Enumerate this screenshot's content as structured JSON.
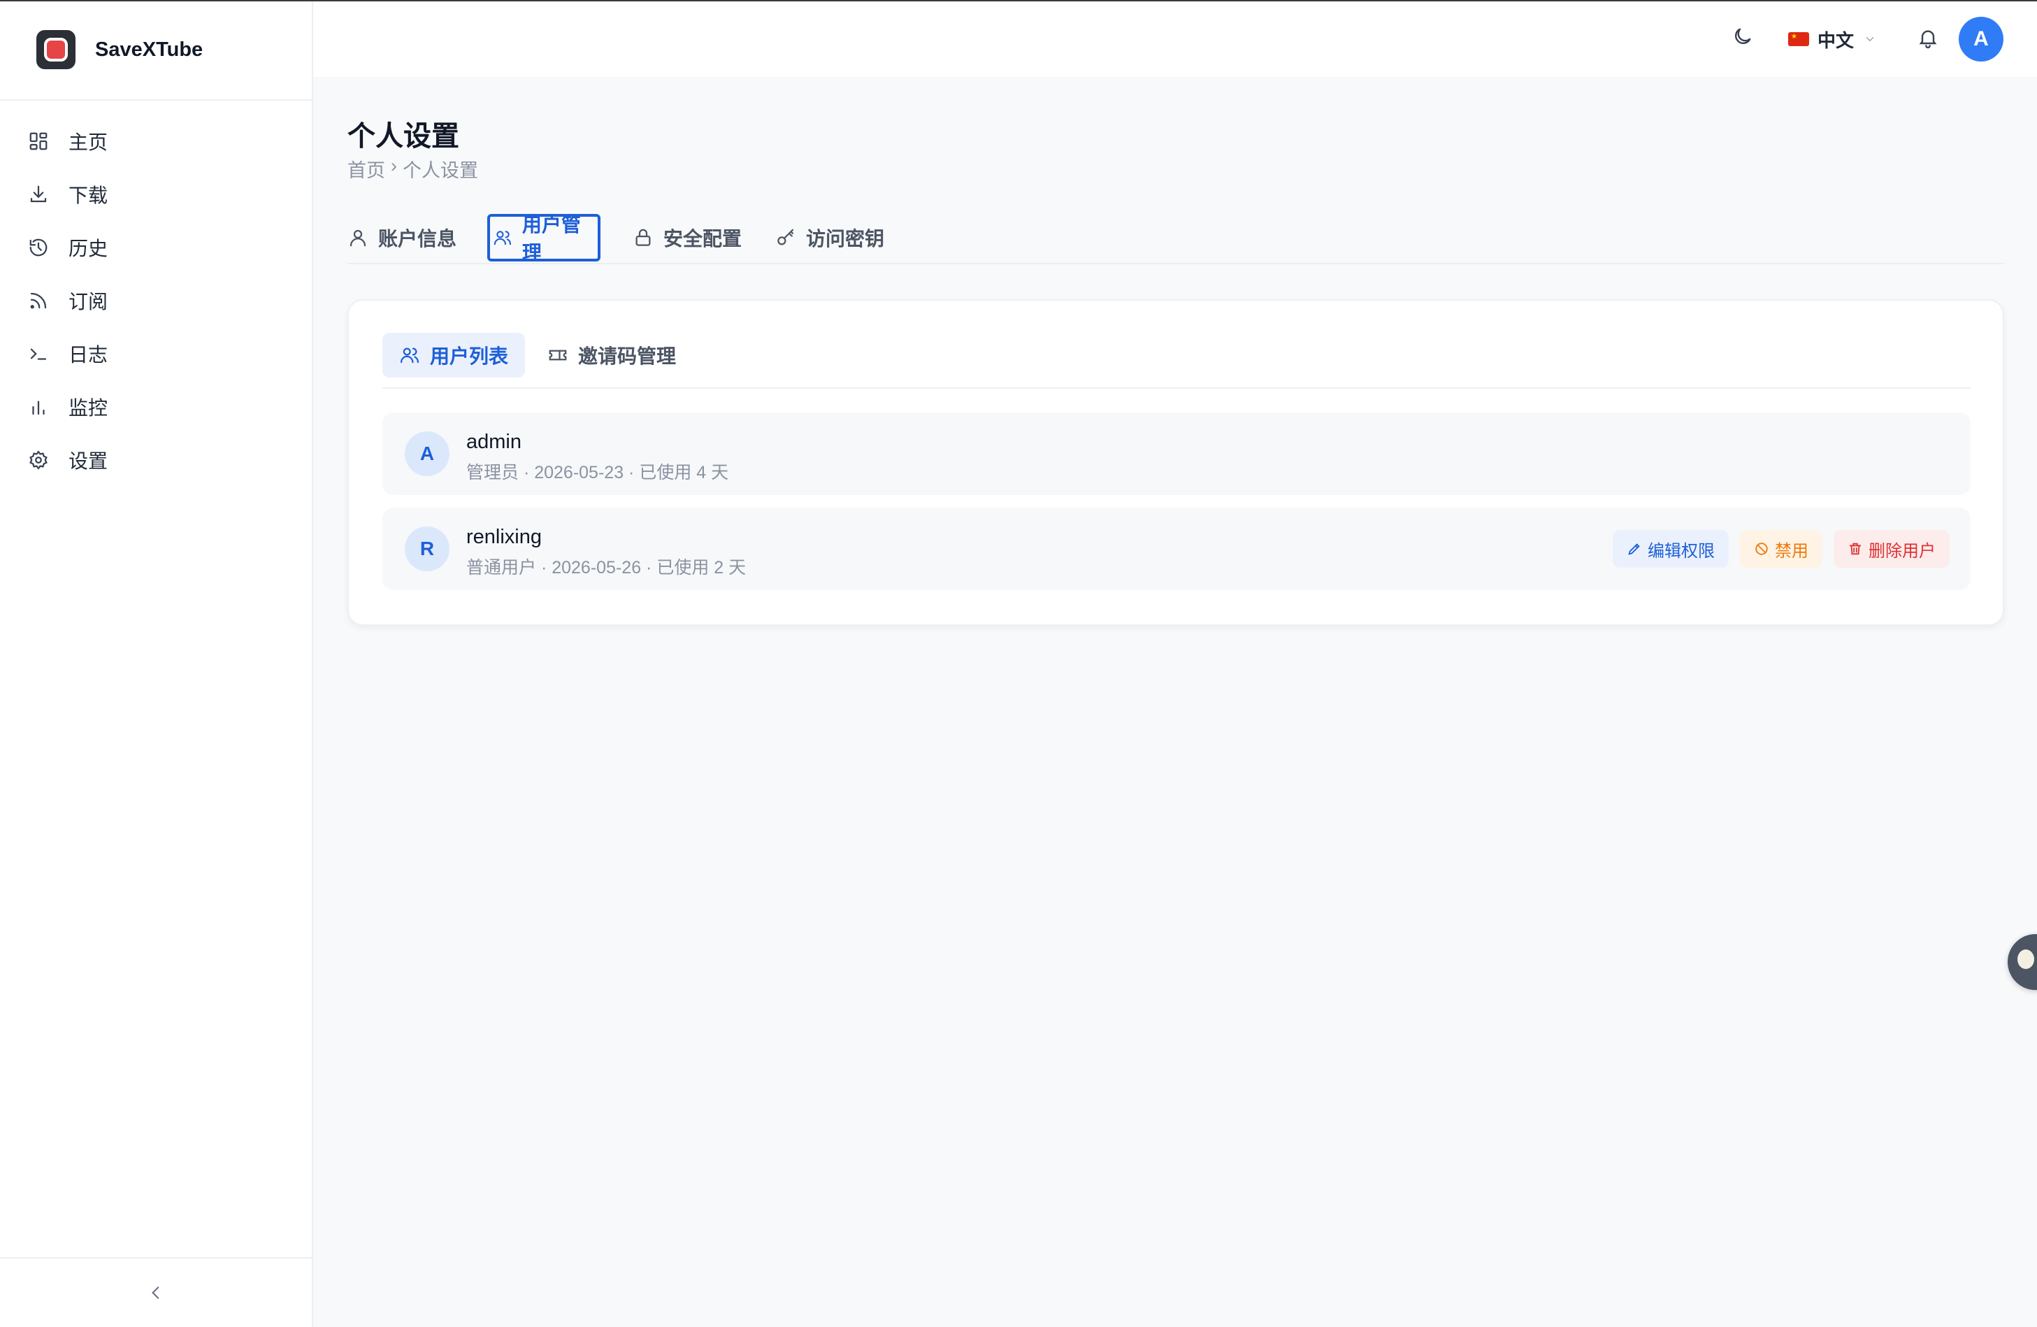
{
  "app": {
    "name": "SaveXTube"
  },
  "sidebar": {
    "items": [
      {
        "label": "主页",
        "icon": "dashboard-icon"
      },
      {
        "label": "下载",
        "icon": "download-icon"
      },
      {
        "label": "历史",
        "icon": "history-icon"
      },
      {
        "label": "订阅",
        "icon": "rss-icon"
      },
      {
        "label": "日志",
        "icon": "terminal-icon"
      },
      {
        "label": "监控",
        "icon": "bar-chart-icon"
      },
      {
        "label": "设置",
        "icon": "gear-icon"
      }
    ]
  },
  "header": {
    "language": "中文",
    "avatar_initial": "A"
  },
  "page": {
    "title": "个人设置",
    "breadcrumb": [
      "首页",
      "›",
      "个人设置"
    ]
  },
  "tabs": [
    {
      "label": "账户信息",
      "icon": "user-icon",
      "active": false
    },
    {
      "label": "用户管理",
      "icon": "users-icon",
      "active": true
    },
    {
      "label": "安全配置",
      "icon": "lock-icon",
      "active": false
    },
    {
      "label": "访问密钥",
      "icon": "key-icon",
      "active": false
    }
  ],
  "subtabs": [
    {
      "label": "用户列表",
      "icon": "users-icon",
      "active": true
    },
    {
      "label": "邀请码管理",
      "icon": "ticket-icon",
      "active": false
    }
  ],
  "users": [
    {
      "initial": "A",
      "name": "admin",
      "meta": "管理员 · 2026-05-23 · 已使用 4 天"
    },
    {
      "initial": "R",
      "name": "renlixing",
      "meta": "普通用户 · 2026-05-26 · 已使用 2 天"
    }
  ],
  "user_actions": {
    "edit": "编辑权限",
    "ban": "禁用",
    "delete": "删除用户"
  },
  "colors": {
    "accent": "#1e5fd8",
    "avatar": "#2f7cf6",
    "warning": "#ef7a0b",
    "danger": "#e03131"
  }
}
